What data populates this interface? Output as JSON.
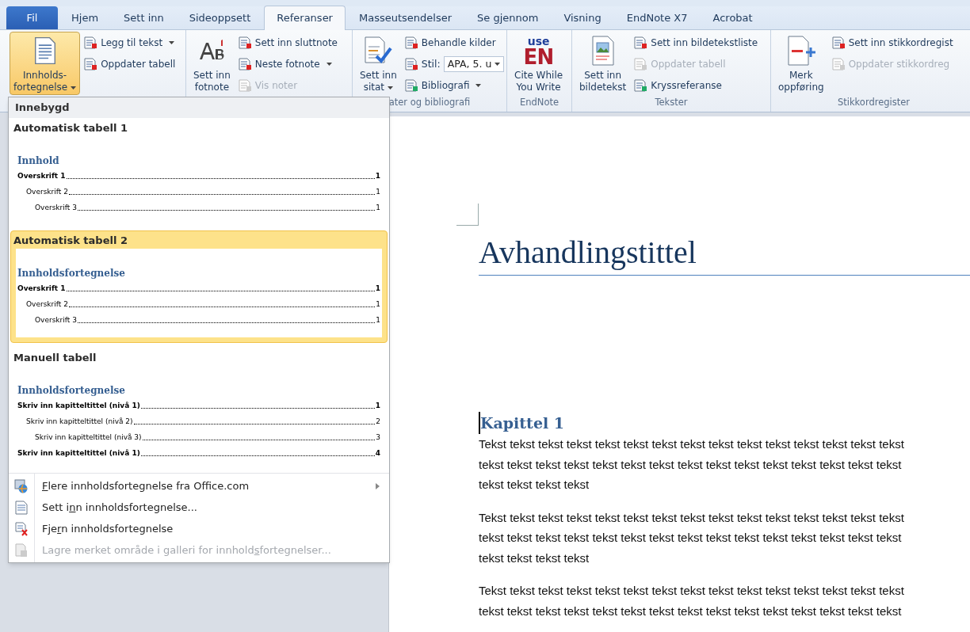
{
  "tabs": [
    {
      "label": "Fil",
      "kind": "file",
      "selected": false
    },
    {
      "label": "Hjem",
      "kind": "tab",
      "selected": false
    },
    {
      "label": "Sett inn",
      "kind": "tab",
      "selected": false
    },
    {
      "label": "Sideoppsett",
      "kind": "tab",
      "selected": false
    },
    {
      "label": "Referanser",
      "kind": "tab",
      "selected": true
    },
    {
      "label": "Masseutsendelser",
      "kind": "tab",
      "selected": false
    },
    {
      "label": "Se gjennom",
      "kind": "tab",
      "selected": false
    },
    {
      "label": "Visning",
      "kind": "tab",
      "selected": false
    },
    {
      "label": "EndNote X7",
      "kind": "tab",
      "selected": false
    },
    {
      "label": "Acrobat",
      "kind": "tab",
      "selected": false
    }
  ],
  "ribbon": {
    "groups": [
      {
        "large": {
          "lines": [
            "Innholds-",
            "fortegnelse"
          ],
          "dropdown": true,
          "pressed": true
        },
        "small": [
          {
            "label": "Legg til tekst",
            "dropdown": true,
            "disabled": false
          },
          {
            "label": "Oppdater tabell",
            "dropdown": false,
            "disabled": false
          }
        ]
      },
      {
        "large": {
          "lines": [
            "Sett inn",
            "fotnote"
          ],
          "dropdown": false,
          "pressed": false
        },
        "small": [
          {
            "label": "Sett inn sluttnote",
            "dropdown": false,
            "disabled": false
          },
          {
            "label": "Neste fotnote",
            "dropdown": true,
            "disabled": false
          },
          {
            "label": "Vis noter",
            "dropdown": false,
            "disabled": true
          }
        ]
      },
      {
        "large": {
          "lines": [
            "Sett inn",
            "sitat"
          ],
          "dropdown": true,
          "pressed": false
        },
        "small": [
          {
            "label": "Behandle kilder",
            "dropdown": false,
            "disabled": false
          },
          {
            "label": "Stil:",
            "kind": "combo",
            "value": "APA, 5. u",
            "dropdown": true
          },
          {
            "label": "Bibliografi",
            "dropdown": true,
            "disabled": false
          }
        ],
        "label": "ater og bibliografi"
      },
      {
        "large": {
          "lines": [
            "Cite While",
            "You Write"
          ],
          "logo": [
            "use",
            "EN"
          ],
          "dropdown": false,
          "pressed": false
        },
        "label": "EndNote"
      },
      {
        "large": {
          "lines": [
            "Sett inn",
            "bildetekst"
          ],
          "dropdown": false,
          "pressed": false
        },
        "small": [
          {
            "label": "Sett inn bildetekstliste",
            "dropdown": false,
            "disabled": false
          },
          {
            "label": "Oppdater tabell",
            "dropdown": false,
            "disabled": true
          },
          {
            "label": "Kryssreferanse",
            "dropdown": false,
            "disabled": false
          }
        ],
        "label": "Tekster"
      },
      {
        "large": {
          "lines": [
            "Merk",
            "oppføring"
          ],
          "dropdown": false,
          "pressed": false
        },
        "small": [
          {
            "label": "Sett inn stikkordregist",
            "dropdown": false,
            "disabled": false
          },
          {
            "label": "Oppdater stikkordreg",
            "dropdown": false,
            "disabled": true
          }
        ],
        "label": "Stikkordregister"
      }
    ]
  },
  "dropdown": {
    "header": "Innebygd",
    "gallery": [
      {
        "title": "Automatisk tabell 1",
        "selected": false,
        "preview": {
          "heading": "Innhold",
          "entries": [
            {
              "text": "Overskrift 1",
              "page": "1",
              "children": [
                {
                  "text": "Overskrift 2",
                  "page": "1",
                  "children": [
                    {
                      "text": "Overskrift 3",
                      "page": "1"
                    }
                  ]
                }
              ]
            }
          ]
        }
      },
      {
        "title": "Automatisk tabell 2",
        "selected": true,
        "preview": {
          "heading": "Innholdsfortegnelse",
          "entries": [
            {
              "text": "Overskrift 1",
              "page": "1",
              "children": [
                {
                  "text": "Overskrift 2",
                  "page": "1",
                  "children": [
                    {
                      "text": "Overskrift 3",
                      "page": "1"
                    }
                  ]
                }
              ]
            }
          ]
        }
      },
      {
        "title": "Manuell tabell",
        "selected": false,
        "preview": {
          "heading": "Innholdsfortegnelse",
          "entries": [
            {
              "text": "Skriv inn kapitteltittel (nivå 1)",
              "page": "1",
              "children": [
                {
                  "text": "Skriv inn kapitteltittel (nivå 2)",
                  "page": "2",
                  "children": [
                    {
                      "text": "Skriv inn kapitteltittel (nivå 3)",
                      "page": "3"
                    }
                  ]
                }
              ]
            },
            {
              "text": "Skriv inn kapitteltittel (nivå 1)",
              "page": "4"
            }
          ]
        }
      }
    ],
    "commands": [
      {
        "access_key": "F",
        "after": "lere innholdsfortegnelse fra Office.com",
        "submenu": true,
        "disabled": false
      },
      {
        "before": "Sett i",
        "access_key": "n",
        "after": "n innholdsfortegnelse...",
        "submenu": false,
        "disabled": false
      },
      {
        "before": "Fje",
        "access_key": "r",
        "after": "n innholdsfortegnelse",
        "submenu": false,
        "disabled": false
      },
      {
        "before": "Lagre merket område i galleri for innhold",
        "access_key": "s",
        "after": "fortegnelser...",
        "submenu": false,
        "disabled": true
      }
    ]
  },
  "document": {
    "title": "Avhandlingstittel",
    "heading": "Kapittel 1",
    "paragraphs": [
      [
        "Tekst tekst tekst tekst tekst tekst tekst tekst tekst tekst tekst tekst tekst tekst tekst",
        "tekst tekst tekst tekst tekst tekst tekst tekst tekst tekst tekst tekst tekst tekst tekst",
        "tekst tekst tekst tekst"
      ],
      [
        "Tekst tekst tekst tekst tekst tekst tekst tekst tekst tekst tekst tekst tekst tekst tekst",
        "tekst tekst tekst tekst tekst tekst tekst tekst tekst tekst tekst tekst tekst tekst tekst",
        "tekst tekst tekst tekst"
      ],
      [
        "Tekst tekst tekst tekst tekst tekst tekst tekst tekst tekst tekst tekst tekst tekst tekst",
        "tekst tekst tekst tekst tekst tekst tekst tekst tekst tekst tekst tekst tekst tekst tekst"
      ]
    ]
  }
}
